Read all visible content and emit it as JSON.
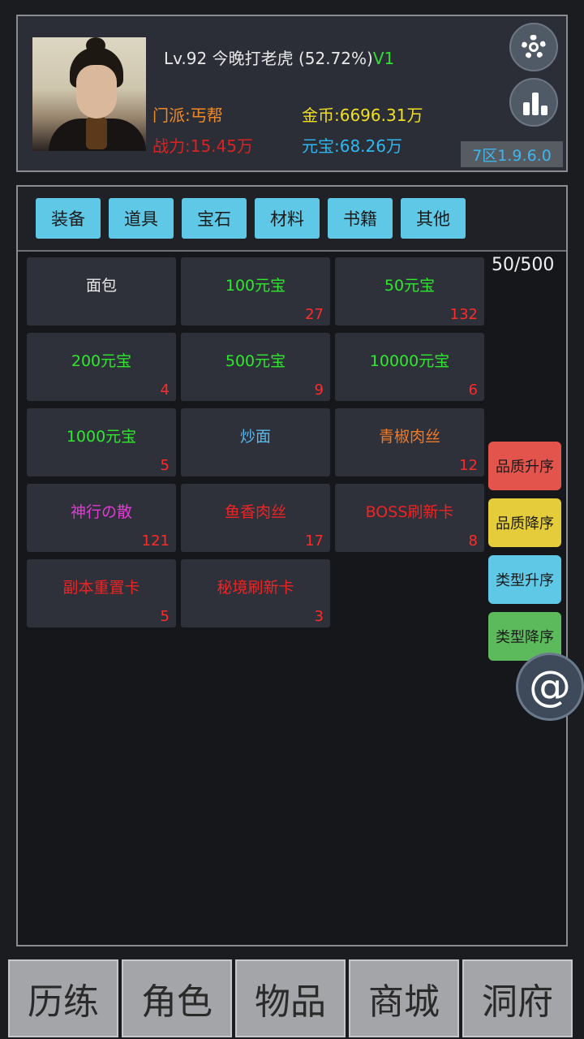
{
  "player": {
    "level": "Lv.92",
    "name": "今晚打老虎",
    "exp_percent": "(52.72%)",
    "vip": "V1",
    "sect": "门派:丐帮",
    "power": "战力:15.45万",
    "gold": "金币:6696.31万",
    "ingot": "元宝:68.26万",
    "server": "7区1.9.6.0"
  },
  "tabs": [
    "装备",
    "道具",
    "宝石",
    "材料",
    "书籍",
    "其他"
  ],
  "capacity": "50/500",
  "items": [
    {
      "name": "面包",
      "count": "",
      "color": "#e8e8e8"
    },
    {
      "name": "100元宝",
      "count": "27",
      "color": "#2ee82e"
    },
    {
      "name": "50元宝",
      "count": "132",
      "color": "#2ee82e"
    },
    {
      "name": "200元宝",
      "count": "4",
      "color": "#2ee82e"
    },
    {
      "name": "500元宝",
      "count": "9",
      "color": "#2ee82e"
    },
    {
      "name": "10000元宝",
      "count": "6",
      "color": "#2ee82e"
    },
    {
      "name": "1000元宝",
      "count": "5",
      "color": "#2ee82e"
    },
    {
      "name": "炒面",
      "count": "",
      "color": "#5ab7ea"
    },
    {
      "name": "青椒肉丝",
      "count": "12",
      "color": "#f07a26"
    },
    {
      "name": "神行の散",
      "count": "121",
      "color": "#e23ad6"
    },
    {
      "name": "鱼香肉丝",
      "count": "17",
      "color": "#ee2424"
    },
    {
      "name": "BOSS刷新卡",
      "count": "8",
      "color": "#ee2424"
    },
    {
      "name": "副本重置卡",
      "count": "5",
      "color": "#ee2424"
    },
    {
      "name": "秘境刷新卡",
      "count": "3",
      "color": "#ee2424"
    }
  ],
  "sort_buttons": [
    {
      "label": "品质升序",
      "color": "#e2544c"
    },
    {
      "label": "品质降序",
      "color": "#e5cc3a"
    },
    {
      "label": "类型升序",
      "color": "#5ec8e6"
    },
    {
      "label": "类型降序",
      "color": "#5cba5c"
    }
  ],
  "at_symbol": "@",
  "nav": [
    "历练",
    "角色",
    "物品",
    "商城",
    "洞府"
  ]
}
